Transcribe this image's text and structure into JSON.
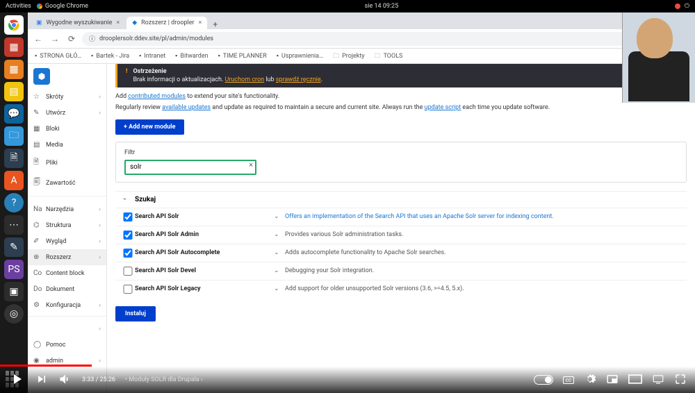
{
  "gnome": {
    "activities": "Activities",
    "app": "Google Chrome",
    "clock": "sie 14  09:25"
  },
  "tabs": [
    {
      "title": "Wygodne wyszukiwanie"
    },
    {
      "title": "Rozszerz | droopler"
    }
  ],
  "url": "drooplersolr.ddev.site/pl/admin/modules",
  "bookmarks": [
    {
      "label": "STRONA GŁÓ…"
    },
    {
      "label": "Bartek - Jira"
    },
    {
      "label": "Intranet"
    },
    {
      "label": "Bitwarden"
    },
    {
      "label": "TIME PLANNER"
    },
    {
      "label": "Usprawnienia…"
    },
    {
      "label": "Projekty",
      "folder": true
    },
    {
      "label": "TOOLS",
      "folder": true
    }
  ],
  "sidebar": {
    "items": [
      {
        "label": "Skróty",
        "icon": "☆",
        "chev": true
      },
      {
        "label": "Utwórz",
        "icon": "✎",
        "chev": true
      },
      {
        "label": "Bloki",
        "icon": "▦"
      },
      {
        "label": "Media",
        "icon": "▤"
      },
      {
        "label": "Pliki",
        "icon": "🗎"
      },
      {
        "label": "Zawartość",
        "icon": "🗐"
      },
      {
        "label": "Narzędzia",
        "icon": "Na",
        "chev": true
      },
      {
        "label": "Struktura",
        "icon": "⌬",
        "chev": true
      },
      {
        "label": "Wygląd",
        "icon": "✐",
        "chev": true
      },
      {
        "label": "Rozszerz",
        "icon": "⊕",
        "chev": true,
        "active": true
      },
      {
        "label": "Content block",
        "icon": "Co"
      },
      {
        "label": "Dokument",
        "icon": "Do"
      },
      {
        "label": "Konfiguracja",
        "icon": "⚙",
        "chev": true
      },
      {
        "label": "",
        "icon": "",
        "chev": true
      },
      {
        "label": "Pomoc",
        "icon": "◯"
      },
      {
        "label": "admin",
        "icon": "◉",
        "chev": true
      }
    ]
  },
  "warning": {
    "title": "Ostrzeżenie",
    "text_pre": "Brak informacji o aktualizacjach. ",
    "link1": "Uruchom cron",
    "mid": " lub ",
    "link2": "sprawdź ręcznie",
    "after": "."
  },
  "intro1_pre": "Add ",
  "intro1_link": "contributed modules",
  "intro1_post": " to extend your site's functionality.",
  "intro2_pre": "Regularly review ",
  "intro2_link1": "available updates",
  "intro2_mid": " and update as required to maintain a secure and current site. Always run the ",
  "intro2_link2": "update script",
  "intro2_post": " each time you update software.",
  "add_module": "+ Add new module",
  "filter": {
    "label": "Filtr",
    "value": "solr"
  },
  "category": "Szukaj",
  "modules": [
    {
      "checked": true,
      "name": "Search API Solr",
      "desc": "Offers an implementation of the Search API that uses an Apache Solr server for indexing content.",
      "link": true
    },
    {
      "checked": true,
      "name": "Search API Solr Admin",
      "desc": "Provides various Solr administration tasks."
    },
    {
      "checked": true,
      "name": "Search API Solr Autocomplete",
      "desc": "Adds autocomplete functionality to Apache Solr searches."
    },
    {
      "checked": false,
      "name": "Search API Solr Devel",
      "desc": "Debugging your Solr integration."
    },
    {
      "checked": false,
      "name": "Search API Solr Legacy",
      "desc": "Add support for older unsupported Solr versions (3.6, >=4.5, 5.x)."
    }
  ],
  "install": "Instaluj",
  "video": {
    "current": "3:33",
    "total": "25:26",
    "chapter": "Moduły SOLR dla Drupala",
    "cc": "cc"
  }
}
